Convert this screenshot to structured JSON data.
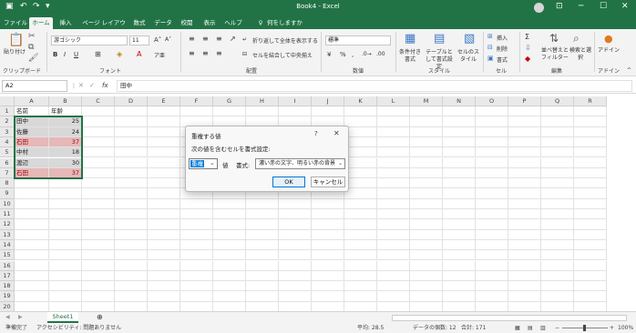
{
  "window": {
    "title": "Book4 - Excel",
    "search_label": "何をしますか"
  },
  "tabs": [
    "ファイル",
    "ホーム",
    "挿入",
    "ページ レイアウト",
    "数式",
    "データ",
    "校閲",
    "表示",
    "ヘルプ"
  ],
  "ribbon": {
    "clipboard": {
      "paste": "貼り付け",
      "group": "クリップボード"
    },
    "font": {
      "name": "游ゴシック",
      "size": "11",
      "group": "フォント"
    },
    "alignment": {
      "wrap": "折り返して全体を表示する",
      "merge": "セルを結合して中央揃え",
      "group": "配置"
    },
    "number": {
      "format": "標準",
      "group": "数値"
    },
    "styles": {
      "conditional": "条件付き書式",
      "table": "テーブルとして書式設定",
      "cell": "セルのスタイル",
      "group": "スタイル"
    },
    "cells": {
      "insert": "挿入",
      "delete": "削除",
      "format": "書式",
      "group": "セル"
    },
    "editing": {
      "sort": "並べ替えとフィルター",
      "find": "検索と選択",
      "group": "編集"
    },
    "addins": {
      "label": "アドイン",
      "group": "アドイン"
    }
  },
  "formula_bar": {
    "name_box": "A2",
    "fx": "fx",
    "value": "田中"
  },
  "columns": [
    "A",
    "B",
    "C",
    "D",
    "E",
    "F",
    "G",
    "H",
    "I",
    "J",
    "K",
    "L",
    "M",
    "N",
    "O",
    "P",
    "Q",
    "R"
  ],
  "rows": [
    "1",
    "2",
    "3",
    "4",
    "5",
    "6",
    "7",
    "8",
    "9",
    "10",
    "11",
    "12",
    "13",
    "14",
    "15",
    "16",
    "17",
    "18",
    "19",
    "20"
  ],
  "cells": [
    {
      "a": "名前",
      "b": "年齢"
    },
    {
      "a": "田中",
      "b": "25"
    },
    {
      "a": "佐藤",
      "b": "24"
    },
    {
      "a": "石田",
      "b": "37"
    },
    {
      "a": "中村",
      "b": "18"
    },
    {
      "a": "渡辺",
      "b": "30"
    },
    {
      "a": "石田",
      "b": "37"
    }
  ],
  "highlight_color": "#e6b8b7",
  "sheet_tab": "Sheet1",
  "status": {
    "ready": "準備完了",
    "accessibility": "アクセシビリティ: 問題ありません",
    "average": "平均: 28.5",
    "count": "データの個数: 12",
    "sum": "合計: 171",
    "zoom": "100%"
  },
  "dialog": {
    "title": "重複する値",
    "label": "次の値を含むセルを書式設定:",
    "value_option": "重複",
    "connector": "値",
    "format_label": "書式:",
    "format_option": "濃い赤の文字、明るい赤の背景",
    "ok": "OK",
    "cancel": "キャンセル"
  },
  "accent_color": "#217346"
}
